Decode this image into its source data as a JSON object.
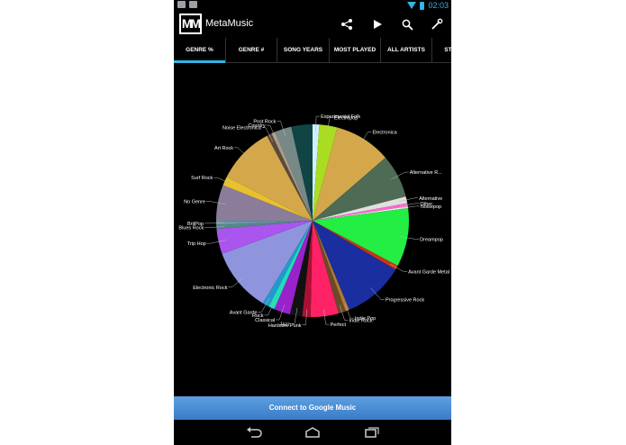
{
  "status_bar": {
    "time": "02:03"
  },
  "action_bar": {
    "logo_text": "MM",
    "title": "MetaMusic",
    "icons": [
      "share-icon",
      "play-icon",
      "search-icon",
      "settings-wrench-icon"
    ]
  },
  "tabs": [
    {
      "label": "GENRE %",
      "active": true
    },
    {
      "label": "GENRE #",
      "active": false
    },
    {
      "label": "SONG YEARS",
      "active": false
    },
    {
      "label": "MOST PLAYED",
      "active": false
    },
    {
      "label": "ALL ARTISTS",
      "active": false
    },
    {
      "label": "STA",
      "active": false
    }
  ],
  "chart_data": {
    "type": "pie",
    "start_angle_deg": 0,
    "direction": "clockwise",
    "slices": [
      {
        "label": "Experimental Folk",
        "value": 1.2,
        "color": "#d0f0ff"
      },
      {
        "label": "Electropop",
        "value": 3.2,
        "color": "#aadd22"
      },
      {
        "label": "Electronica",
        "value": 10.2,
        "color": "#d4a84a"
      },
      {
        "label": "Alternative R...",
        "value": 7.8,
        "color": "#4d6b55"
      },
      {
        "label": "Alternative",
        "value": 1.2,
        "color": "#e0e0e0"
      },
      {
        "label": "Other",
        "value": 0.6,
        "color": "#ff66cc"
      },
      {
        "label": "Noisepop",
        "value": 0.3,
        "color": "#f0f0f0"
      },
      {
        "label": "Dreampop",
        "value": 10.5,
        "color": "#22ee44"
      },
      {
        "label": "Avant Garde Metal",
        "value": 0.8,
        "color": "#cc3311"
      },
      {
        "label": "Progressive Rock",
        "value": 11.0,
        "color": "#1a2ea0"
      },
      {
        "label": "Indie Pop",
        "value": 0.7,
        "color": "#b07a30"
      },
      {
        "label": "Indie Rock",
        "value": 1.3,
        "color": "#6b4a2a"
      },
      {
        "label": "Perfect",
        "value": 5.0,
        "color": "#ff2266"
      },
      {
        "label": "Hardcore Punk",
        "value": 1.5,
        "color": "#aa1133"
      },
      {
        "label": "Jazz",
        "value": 2.2,
        "color": "#111111"
      },
      {
        "label": "Classical",
        "value": 2.9,
        "color": "#9922cc"
      },
      {
        "label": "Rock",
        "value": 1.1,
        "color": "#22ddbb"
      },
      {
        "label": "Avant Garde",
        "value": 1.2,
        "color": "#2299cc"
      },
      {
        "label": "Electronic Rock",
        "value": 11.5,
        "color": "#8f95dd"
      },
      {
        "label": "Trip Hop",
        "value": 4.5,
        "color": "#aa55ee"
      },
      {
        "label": "Blues Rock",
        "value": 0.7,
        "color": "#558888"
      },
      {
        "label": "BritPop",
        "value": 0.7,
        "color": "#6699aa"
      },
      {
        "label": "No Genre",
        "value": 6.5,
        "color": "#8b7d99"
      },
      {
        "label": "Surf Rock",
        "value": 1.6,
        "color": "#e8c030"
      },
      {
        "label": "Art Rock",
        "value": 10.3,
        "color": "#d4a84a"
      },
      {
        "label": "Noise Electronica",
        "value": 0.9,
        "color": "#5a4a3a"
      },
      {
        "label": "Country",
        "value": 0.7,
        "color": "#aa9988"
      },
      {
        "label": "Post Rock",
        "value": 3.0,
        "color": "#778888"
      },
      {
        "label": "",
        "value": 3.8,
        "color": "#114444"
      }
    ]
  },
  "connect_button": {
    "label": "Connect to Google Music"
  },
  "nav_bar": {
    "icons": [
      "back-icon",
      "home-icon",
      "recents-icon"
    ]
  }
}
